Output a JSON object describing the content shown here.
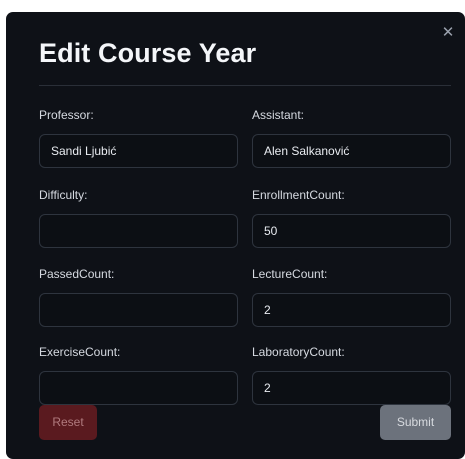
{
  "modal": {
    "title": "Edit Course Year",
    "close_icon": "close-icon"
  },
  "fields": {
    "professor": {
      "label": "Professor:",
      "value": "Sandi Ljubić"
    },
    "assistant": {
      "label": "Assistant:",
      "value": "Alen Salkanović"
    },
    "difficulty": {
      "label": "Difficulty:",
      "value": ""
    },
    "enrollment_count": {
      "label": "EnrollmentCount:",
      "value": "50"
    },
    "passed_count": {
      "label": "PassedCount:",
      "value": ""
    },
    "lecture_count": {
      "label": "LectureCount:",
      "value": "2"
    },
    "exercise_count": {
      "label": "ExerciseCount:",
      "value": ""
    },
    "laboratory_count": {
      "label": "LaboratoryCount:",
      "value": "2"
    }
  },
  "actions": {
    "reset_label": "Reset",
    "submit_label": "Submit"
  },
  "colors": {
    "modal_background": "#0e1117",
    "reset_button": "#5a1a1f",
    "submit_button": "#6c727c"
  }
}
